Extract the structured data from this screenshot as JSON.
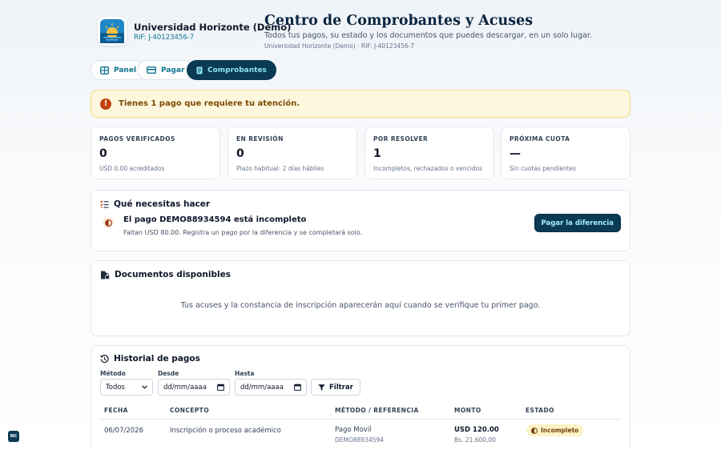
{
  "org": {
    "name": "Universidad Horizonte (Demo)",
    "rif": "RIF: J-40123456-7"
  },
  "page": {
    "title": "Centro de Comprobantes y Acuses",
    "subtitle": "Todos tus pagos, su estado y los documentos que puedes descargar, en un solo lugar.",
    "meta": "Universidad Horizonte (Demo) · RIF: J-40123456-7"
  },
  "tabs": [
    {
      "label": "Panel",
      "icon": "panel-icon"
    },
    {
      "label": "Pagar",
      "icon": "card-icon"
    },
    {
      "label": "Comprobantes",
      "icon": "receipt-icon",
      "active": true
    }
  ],
  "alert": {
    "text": "Tienes 1 pago que requiere tu atención."
  },
  "stats": [
    {
      "label": "PAGOS VERIFICADOS",
      "value": "0",
      "note": "USD 0.00 acreditados"
    },
    {
      "label": "EN REVISIÓN",
      "value": "0",
      "note": "Plazo habitual: 2 días hábiles"
    },
    {
      "label": "POR RESOLVER",
      "value": "1",
      "note": "Incompletos, rechazados o vencidos"
    },
    {
      "label": "PRÓXIMA CUOTA",
      "value": "—",
      "note": "Sin cuotas pendientes"
    }
  ],
  "todo": {
    "title": "Qué necesitas hacer",
    "item_title": "El pago DEMO88934594 está incompleto",
    "item_desc": "Faltan USD 80.00. Registra un pago por la diferencia y se completará solo.",
    "action_label": "Pagar la diferencia"
  },
  "docs": {
    "title": "Documentos disponibles",
    "empty_text": "Tus acuses y la constancia de inscripción aparecerán aquí cuando se verifique tu primer pago."
  },
  "history": {
    "title": "Historial de pagos",
    "filters": {
      "method_label": "Método",
      "method_value": "Todos",
      "from_label": "Desde",
      "from_placeholder": "dd/mm/aaaa",
      "to_label": "Hasta",
      "to_placeholder": "dd/mm/aaaa",
      "filter_label": "Filtrar"
    },
    "columns": [
      "FECHA",
      "CONCEPTO",
      "MÉTODO / REFERENCIA",
      "MONTO",
      "ESTADO"
    ],
    "rows": [
      {
        "date": "06/07/2026",
        "concept": "Inscripción o proceso académico",
        "method": "Pago Movil",
        "reference": "DEMO88934594",
        "amount": "USD 120.00",
        "amount_bs": "Bs. 21.600,00",
        "status": "Incompleto"
      }
    ]
  },
  "corner_badge": "NC",
  "colors": {
    "primary": "#0b3a55",
    "accent": "#0e7490",
    "warning_bg": "#fdf7dd",
    "warning_icon": "#c2410c"
  }
}
